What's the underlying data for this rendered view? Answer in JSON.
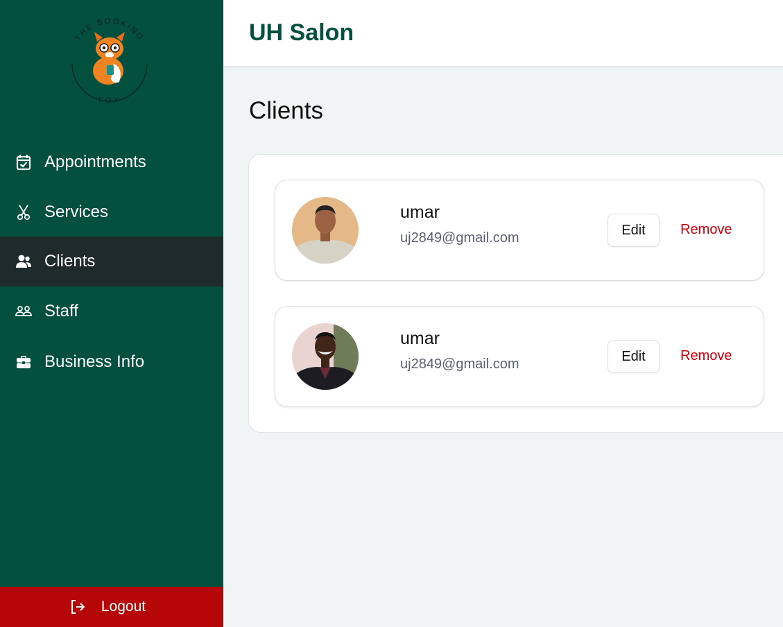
{
  "sidebar": {
    "logo": {
      "text_top": "THE BOOKING",
      "text_bottom": "FOX"
    },
    "items": [
      {
        "label": "Appointments",
        "icon": "calendar-check-icon"
      },
      {
        "label": "Services",
        "icon": "scissors-icon"
      },
      {
        "label": "Clients",
        "icon": "users-icon",
        "active": true
      },
      {
        "label": "Staff",
        "icon": "staff-icon"
      },
      {
        "label": "Business Info",
        "icon": "briefcase-icon"
      }
    ],
    "logout_label": "Logout"
  },
  "header": {
    "title": "UH Salon"
  },
  "main": {
    "title": "Clients",
    "clients": [
      {
        "name": "umar",
        "email": "uj2849@gmail.com",
        "edit_label": "Edit",
        "remove_label": "Remove"
      },
      {
        "name": "umar",
        "email": "uj2849@gmail.com",
        "edit_label": "Edit",
        "remove_label": "Remove"
      }
    ]
  },
  "colors": {
    "sidebar_bg": "#03503f",
    "sidebar_active_bg": "#1f2b2a",
    "logout_bg": "#b50608",
    "brand_title": "#03503f",
    "remove_text": "#d1000a",
    "page_bg": "#eef5f4"
  }
}
